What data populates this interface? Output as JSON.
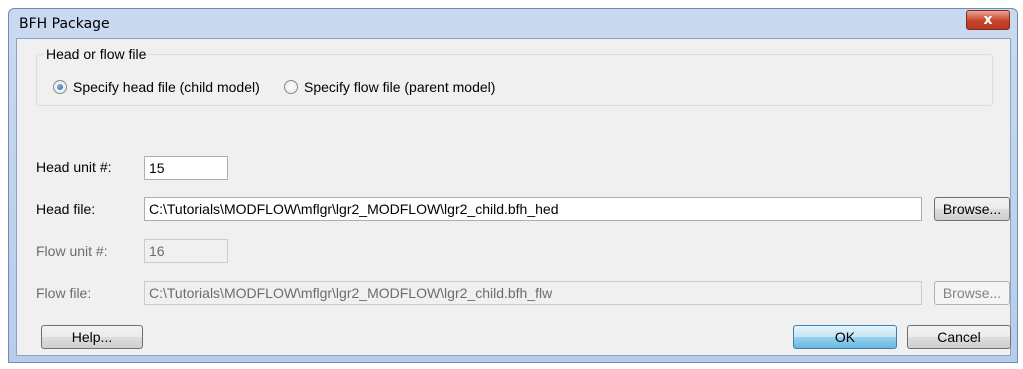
{
  "window": {
    "title": "BFH Package",
    "close_glyph": "x",
    "close_icon": "close-icon"
  },
  "head_or_flow": {
    "legend": "Head or flow file",
    "options": [
      {
        "label": "Specify head file (child model)",
        "selected": true
      },
      {
        "label": "Specify flow file (parent model)",
        "selected": false
      }
    ]
  },
  "fields": {
    "head_unit": {
      "label": "Head unit #:",
      "value": "15",
      "enabled": true
    },
    "head_file": {
      "label": "Head file:",
      "value": "C:\\Tutorials\\MODFLOW\\mflgr\\lgr2_MODFLOW\\lgr2_child.bfh_hed",
      "enabled": true
    },
    "flow_unit": {
      "label": "Flow unit #:",
      "value": "16",
      "enabled": false
    },
    "flow_file": {
      "label": "Flow file:",
      "value": "C:\\Tutorials\\MODFLOW\\mflgr\\lgr2_MODFLOW\\lgr2_child.bfh_flw",
      "enabled": false
    }
  },
  "buttons": {
    "browse_head": "Browse...",
    "browse_flow": "Browse...",
    "help": "Help...",
    "ok": "OK",
    "cancel": "Cancel"
  },
  "colors": {
    "title_bar": "#c9daf0",
    "close_button": "#c6432a",
    "dialog_background": "#f0f0f0",
    "default_button": "#98d1ef"
  }
}
